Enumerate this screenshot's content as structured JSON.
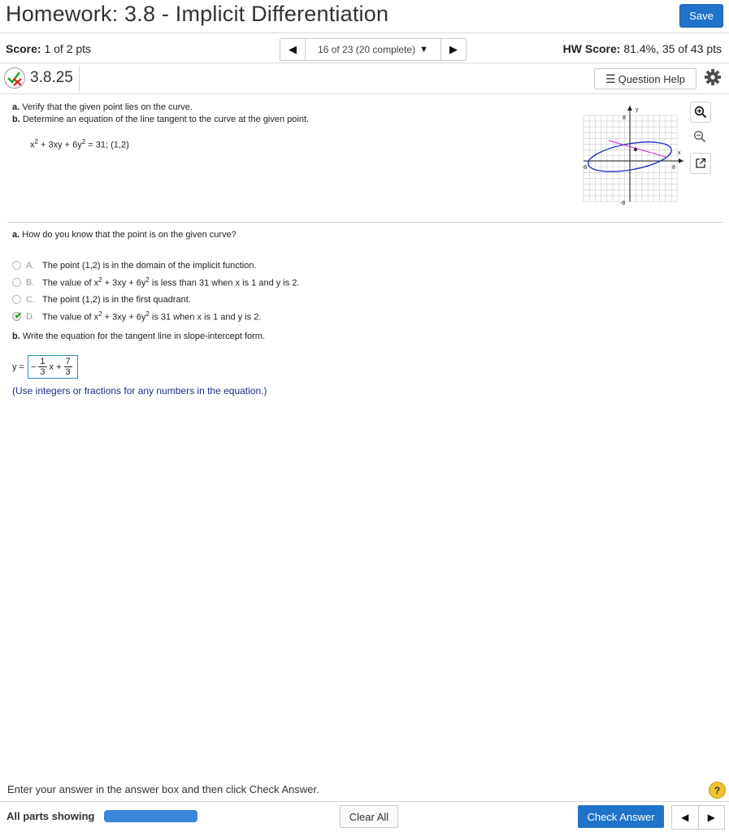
{
  "header": {
    "title": "Homework: 3.8 - Implicit Differentiation",
    "save_label": "Save"
  },
  "score": {
    "label": "Score:",
    "value": "1 of 2 pts"
  },
  "nav": {
    "position": "16 of 23 (20 complete)"
  },
  "hw_score": {
    "label": "HW Score:",
    "value": "81.4%, 35 of 43 pts"
  },
  "question": {
    "number": "3.8.25",
    "help_label": "Question Help",
    "part_a_prefix": "a.",
    "part_a_text": "Verify that the given point lies on the curve.",
    "part_b_prefix": "b.",
    "part_b_text": "Determine an equation of the line tangent to the curve at the given point.",
    "equation_rest": "= 31; (1,2)"
  },
  "graph": {
    "y_label": "y",
    "x_label": "x",
    "y_top": "8",
    "y_bottom": "-8",
    "x_left": "-8",
    "x_right": "8"
  },
  "part_a": {
    "prefix": "a.",
    "prompt": "How do you know that the point is on the given curve?",
    "choices": [
      {
        "letter": "A.",
        "text": "The point (1,2) is in the domain of the implicit function.",
        "selected": false
      },
      {
        "letter": "B.",
        "text_before": "The value of x",
        "text_after": "is less than 31 when x is 1 and y is 2.",
        "selected": false
      },
      {
        "letter": "C.",
        "text": "The point (1,2) is in the first quadrant.",
        "selected": false
      },
      {
        "letter": "D.",
        "text_before": "The value of x",
        "text_after": "is 31 when x is 1 and y is 2.",
        "selected": true
      }
    ]
  },
  "part_b": {
    "prefix": "b.",
    "prompt": "Write the equation for the tangent line in slope-intercept form.",
    "answer_lhs": "y =",
    "answer": {
      "sign": "−",
      "num1": "1",
      "den1": "3",
      "mid": "x +",
      "num2": "7",
      "den2": "3"
    },
    "hint": "(Use integers or fractions for any numbers in the equation.)"
  },
  "footer": {
    "instruction": "Enter your answer in the answer box and then click Check Answer.",
    "all_parts": "All parts showing",
    "clear_label": "Clear All",
    "check_label": "Check Answer",
    "help_symbol": "?"
  },
  "colors": {
    "accent": "#1f74c9",
    "ellipse": "#1c2fc8",
    "tangent": "#d42fcf",
    "check": "#2aa12a"
  }
}
